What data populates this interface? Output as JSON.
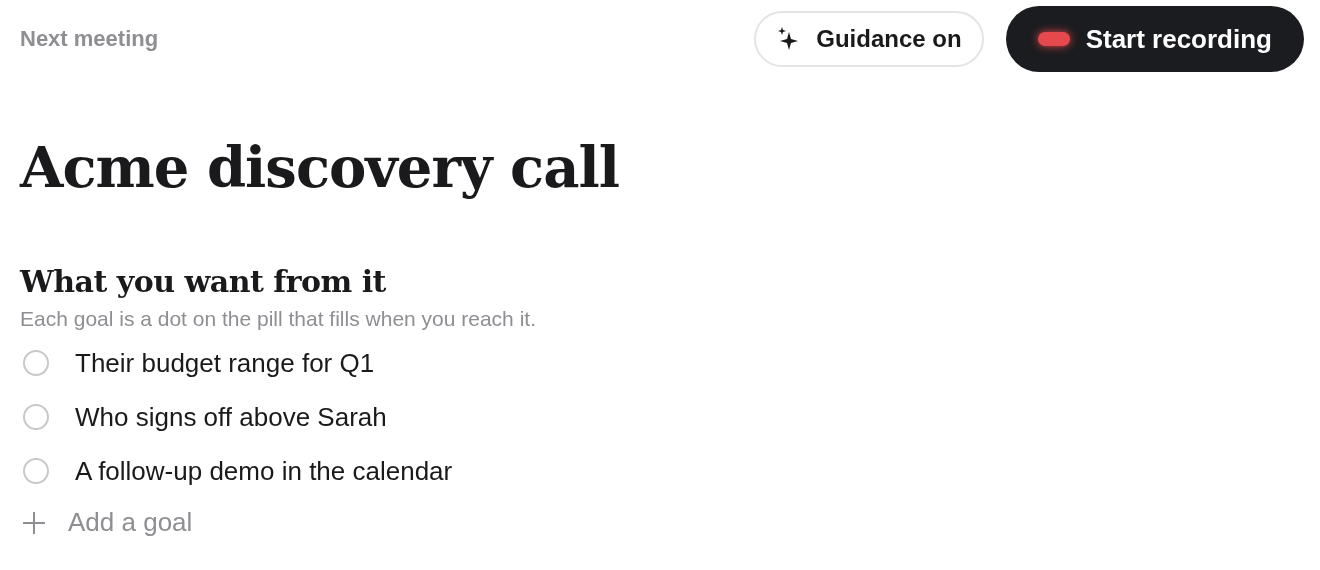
{
  "header": {
    "label": "Next meeting",
    "guidance_button": "Guidance on",
    "record_button": "Start recording"
  },
  "title": "Acme discovery call",
  "goals_section": {
    "heading": "What you want from it",
    "hint": "Each goal is a dot on the pill that fills when you reach it.",
    "goals": [
      {
        "text": "Their budget range for Q1",
        "checked": false
      },
      {
        "text": "Who signs off above Sarah",
        "checked": false
      },
      {
        "text": "A follow-up demo in the calendar",
        "checked": false
      }
    ],
    "add_goal": "Add a goal"
  }
}
